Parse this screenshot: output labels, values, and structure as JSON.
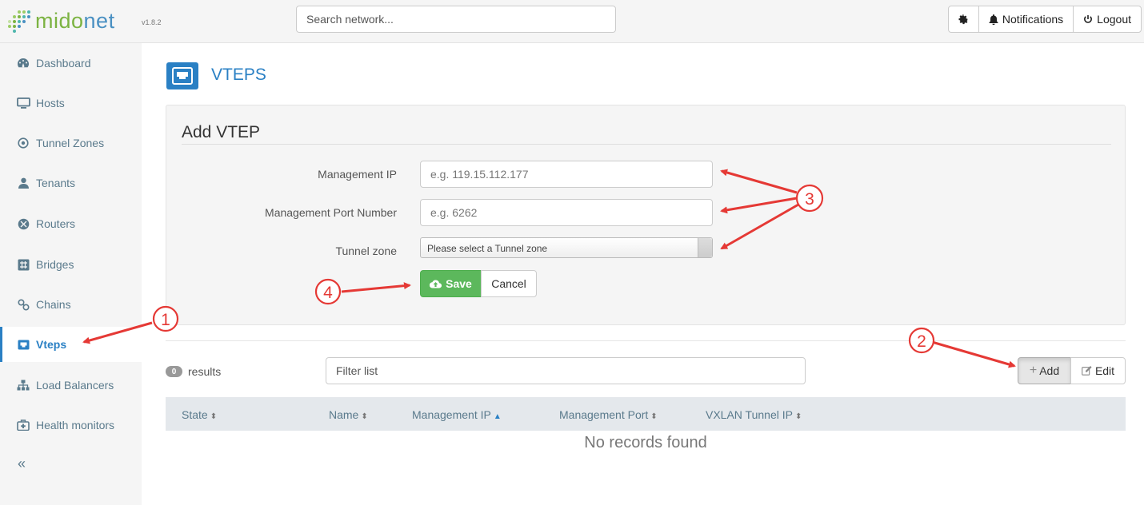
{
  "app": {
    "logo_text_a": "mido",
    "logo_text_b": "net",
    "version": "v1.8.2"
  },
  "search": {
    "placeholder": "Search network..."
  },
  "top_actions": {
    "settings_icon": "gear-icon",
    "notifications_label": "Notifications",
    "logout_label": "Logout"
  },
  "sidebar": {
    "items": [
      {
        "label": "Dashboard",
        "icon": "dashboard-icon"
      },
      {
        "label": "Hosts",
        "icon": "monitor-icon"
      },
      {
        "label": "Tunnel Zones",
        "icon": "target-icon"
      },
      {
        "label": "Tenants",
        "icon": "user-icon"
      },
      {
        "label": "Routers",
        "icon": "router-icon"
      },
      {
        "label": "Bridges",
        "icon": "bridge-icon"
      },
      {
        "label": "Chains",
        "icon": "link-icon"
      },
      {
        "label": "Vteps",
        "icon": "vtep-icon",
        "active": true
      },
      {
        "label": "Load Balancers",
        "icon": "sitemap-icon"
      },
      {
        "label": "Health monitors",
        "icon": "medkit-icon"
      }
    ],
    "collapse_label": "«"
  },
  "page": {
    "title": "VTEPS"
  },
  "add_form": {
    "title": "Add VTEP",
    "management_ip_label": "Management IP",
    "management_ip_placeholder": "e.g. 119.15.112.177",
    "management_ip_value": "",
    "port_label": "Management Port Number",
    "port_placeholder": "e.g. 6262",
    "port_value": "",
    "tunnel_zone_label": "Tunnel zone",
    "tunnel_zone_selected": "Please select a Tunnel zone",
    "save_label": "Save",
    "cancel_label": "Cancel"
  },
  "list": {
    "count": "0",
    "results_label": "results",
    "filter_placeholder": "Filter list",
    "add_label": "Add",
    "edit_label": "Edit",
    "columns": [
      "State",
      "Name",
      "Management IP",
      "Management Port",
      "VXLAN Tunnel IP"
    ],
    "sorted_column": "Management IP",
    "empty_message": "No records found"
  },
  "annotations": {
    "marker_1": "1",
    "marker_2": "2",
    "marker_3": "3",
    "marker_4": "4",
    "color": "#e53935"
  },
  "colors": {
    "accent": "#2a80c4",
    "save": "#5cb85c",
    "logo_green": "#7cb342"
  }
}
